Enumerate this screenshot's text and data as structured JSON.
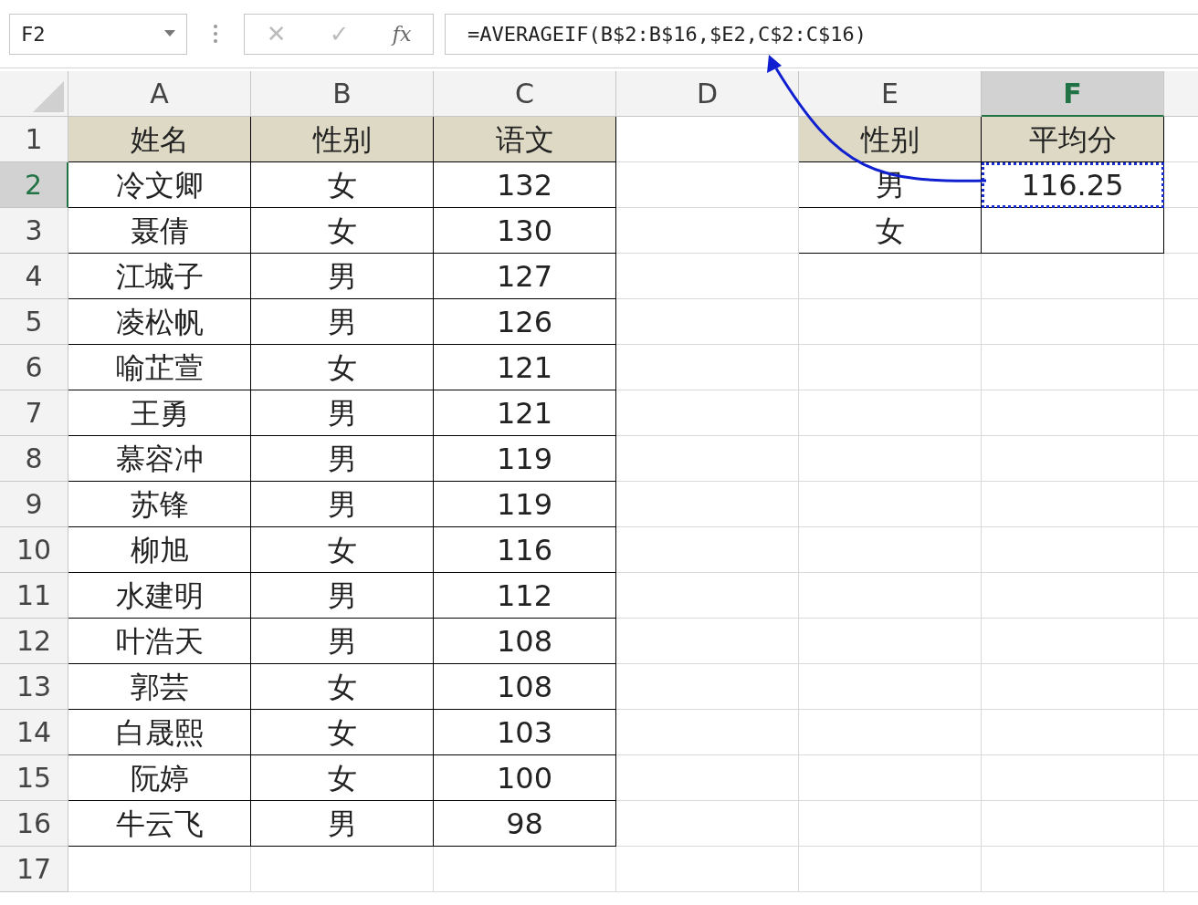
{
  "name_box": "F2",
  "formula_bar": {
    "cancel": "✕",
    "enter": "✓",
    "function": "fx",
    "formula": "=AVERAGEIF(B$2:B$16,$E2,C$2:C$16)"
  },
  "columns": [
    {
      "label": "A",
      "selected": false
    },
    {
      "label": "B",
      "selected": false
    },
    {
      "label": "C",
      "selected": false
    },
    {
      "label": "D",
      "selected": false
    },
    {
      "label": "E",
      "selected": false
    },
    {
      "label": "F",
      "selected": true
    }
  ],
  "rows": [
    {
      "number": "1",
      "selected": false,
      "cells": [
        {
          "kind": "header",
          "text": "姓名",
          "selected": false
        },
        {
          "kind": "header",
          "text": "性别",
          "selected": false
        },
        {
          "kind": "header",
          "text": "语文",
          "selected": false
        },
        {
          "kind": "blank",
          "selected": false
        },
        {
          "kind": "header",
          "text": "性别",
          "selected": false
        },
        {
          "kind": "header",
          "text": "平均分",
          "selected": false
        }
      ]
    },
    {
      "number": "2",
      "selected": true,
      "cells": [
        {
          "kind": "data",
          "text": "冷文卿",
          "selected": false
        },
        {
          "kind": "data",
          "text": "女",
          "selected": false
        },
        {
          "kind": "data",
          "text": "132",
          "selected": false
        },
        {
          "kind": "blank",
          "selected": false
        },
        {
          "kind": "data",
          "text": "男",
          "selected": false
        },
        {
          "kind": "data",
          "text": "116.25",
          "selected": true
        }
      ]
    },
    {
      "number": "3",
      "selected": false,
      "cells": [
        {
          "kind": "data",
          "text": "聂倩",
          "selected": false
        },
        {
          "kind": "data",
          "text": "女",
          "selected": false
        },
        {
          "kind": "data",
          "text": "130",
          "selected": false
        },
        {
          "kind": "blank",
          "selected": false
        },
        {
          "kind": "data",
          "text": "女",
          "selected": false
        },
        {
          "kind": "data",
          "selected": false
        }
      ]
    },
    {
      "number": "4",
      "selected": false,
      "cells": [
        {
          "kind": "data",
          "text": "江城子",
          "selected": false
        },
        {
          "kind": "data",
          "text": "男",
          "selected": false
        },
        {
          "kind": "data",
          "text": "127",
          "selected": false
        },
        {
          "kind": "blank",
          "selected": false
        },
        {
          "kind": "blank",
          "selected": false
        },
        {
          "kind": "blank",
          "selected": false
        }
      ]
    },
    {
      "number": "5",
      "selected": false,
      "cells": [
        {
          "kind": "data",
          "text": "凌松帆",
          "selected": false
        },
        {
          "kind": "data",
          "text": "男",
          "selected": false
        },
        {
          "kind": "data",
          "text": "126",
          "selected": false
        },
        {
          "kind": "blank",
          "selected": false
        },
        {
          "kind": "blank",
          "selected": false
        },
        {
          "kind": "blank",
          "selected": false
        }
      ]
    },
    {
      "number": "6",
      "selected": false,
      "cells": [
        {
          "kind": "data",
          "text": "喻芷萱",
          "selected": false
        },
        {
          "kind": "data",
          "text": "女",
          "selected": false
        },
        {
          "kind": "data",
          "text": "121",
          "selected": false
        },
        {
          "kind": "blank",
          "selected": false
        },
        {
          "kind": "blank",
          "selected": false
        },
        {
          "kind": "blank",
          "selected": false
        }
      ]
    },
    {
      "number": "7",
      "selected": false,
      "cells": [
        {
          "kind": "data",
          "text": "王勇",
          "selected": false
        },
        {
          "kind": "data",
          "text": "男",
          "selected": false
        },
        {
          "kind": "data",
          "text": "121",
          "selected": false
        },
        {
          "kind": "blank",
          "selected": false
        },
        {
          "kind": "blank",
          "selected": false
        },
        {
          "kind": "blank",
          "selected": false
        }
      ]
    },
    {
      "number": "8",
      "selected": false,
      "cells": [
        {
          "kind": "data",
          "text": "慕容冲",
          "selected": false
        },
        {
          "kind": "data",
          "text": "男",
          "selected": false
        },
        {
          "kind": "data",
          "text": "119",
          "selected": false
        },
        {
          "kind": "blank",
          "selected": false
        },
        {
          "kind": "blank",
          "selected": false
        },
        {
          "kind": "blank",
          "selected": false
        }
      ]
    },
    {
      "number": "9",
      "selected": false,
      "cells": [
        {
          "kind": "data",
          "text": "苏锋",
          "selected": false
        },
        {
          "kind": "data",
          "text": "男",
          "selected": false
        },
        {
          "kind": "data",
          "text": "119",
          "selected": false
        },
        {
          "kind": "blank",
          "selected": false
        },
        {
          "kind": "blank",
          "selected": false
        },
        {
          "kind": "blank",
          "selected": false
        }
      ]
    },
    {
      "number": "10",
      "selected": false,
      "cells": [
        {
          "kind": "data",
          "text": "柳旭",
          "selected": false
        },
        {
          "kind": "data",
          "text": "女",
          "selected": false
        },
        {
          "kind": "data",
          "text": "116",
          "selected": false
        },
        {
          "kind": "blank",
          "selected": false
        },
        {
          "kind": "blank",
          "selected": false
        },
        {
          "kind": "blank",
          "selected": false
        }
      ]
    },
    {
      "number": "11",
      "selected": false,
      "cells": [
        {
          "kind": "data",
          "text": "水建明",
          "selected": false
        },
        {
          "kind": "data",
          "text": "男",
          "selected": false
        },
        {
          "kind": "data",
          "text": "112",
          "selected": false
        },
        {
          "kind": "blank",
          "selected": false
        },
        {
          "kind": "blank",
          "selected": false
        },
        {
          "kind": "blank",
          "selected": false
        }
      ]
    },
    {
      "number": "12",
      "selected": false,
      "cells": [
        {
          "kind": "data",
          "text": "叶浩天",
          "selected": false
        },
        {
          "kind": "data",
          "text": "男",
          "selected": false
        },
        {
          "kind": "data",
          "text": "108",
          "selected": false
        },
        {
          "kind": "blank",
          "selected": false
        },
        {
          "kind": "blank",
          "selected": false
        },
        {
          "kind": "blank",
          "selected": false
        }
      ]
    },
    {
      "number": "13",
      "selected": false,
      "cells": [
        {
          "kind": "data",
          "text": "郭芸",
          "selected": false
        },
        {
          "kind": "data",
          "text": "女",
          "selected": false
        },
        {
          "kind": "data",
          "text": "108",
          "selected": false
        },
        {
          "kind": "blank",
          "selected": false
        },
        {
          "kind": "blank",
          "selected": false
        },
        {
          "kind": "blank",
          "selected": false
        }
      ]
    },
    {
      "number": "14",
      "selected": false,
      "cells": [
        {
          "kind": "data",
          "text": "白晟熙",
          "selected": false
        },
        {
          "kind": "data",
          "text": "女",
          "selected": false
        },
        {
          "kind": "data",
          "text": "103",
          "selected": false
        },
        {
          "kind": "blank",
          "selected": false
        },
        {
          "kind": "blank",
          "selected": false
        },
        {
          "kind": "blank",
          "selected": false
        }
      ]
    },
    {
      "number": "15",
      "selected": false,
      "cells": [
        {
          "kind": "data",
          "text": "阮婷",
          "selected": false
        },
        {
          "kind": "data",
          "text": "女",
          "selected": false
        },
        {
          "kind": "data",
          "text": "100",
          "selected": false
        },
        {
          "kind": "blank",
          "selected": false
        },
        {
          "kind": "blank",
          "selected": false
        },
        {
          "kind": "blank",
          "selected": false
        }
      ]
    },
    {
      "number": "16",
      "selected": false,
      "cells": [
        {
          "kind": "data",
          "text": "牛云飞",
          "selected": false
        },
        {
          "kind": "data",
          "text": "男",
          "selected": false
        },
        {
          "kind": "data",
          "text": "98",
          "selected": false
        },
        {
          "kind": "blank",
          "selected": false
        },
        {
          "kind": "blank",
          "selected": false
        },
        {
          "kind": "blank",
          "selected": false
        }
      ]
    },
    {
      "number": "17",
      "selected": false,
      "cells": [
        {
          "kind": "blank",
          "selected": false
        },
        {
          "kind": "blank",
          "selected": false
        },
        {
          "kind": "blank",
          "selected": false
        },
        {
          "kind": "blank",
          "selected": false
        },
        {
          "kind": "blank",
          "selected": false
        },
        {
          "kind": "blank",
          "selected": false
        }
      ]
    }
  ]
}
